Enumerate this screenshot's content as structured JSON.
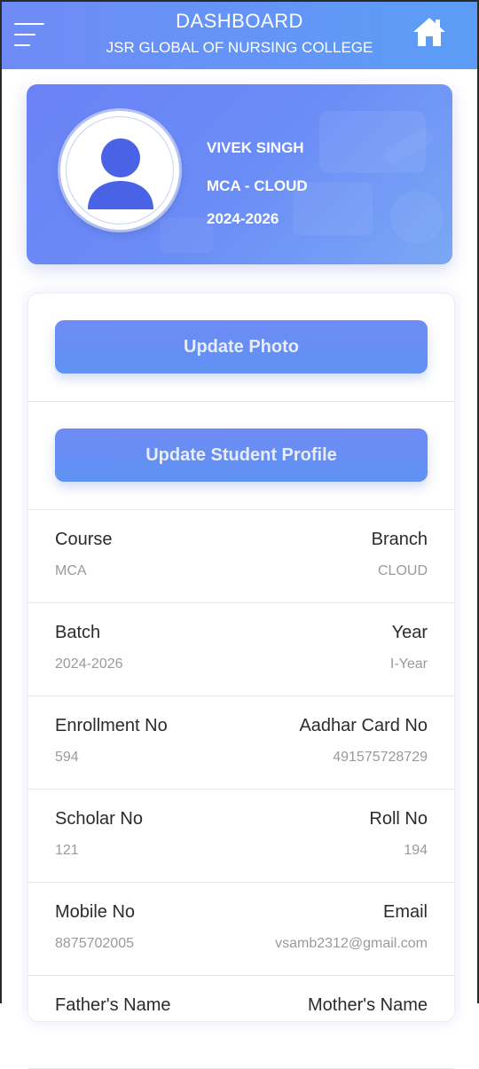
{
  "header": {
    "title": "DASHBOARD",
    "subtitle": "JSR GLOBAL OF NURSING COLLEGE"
  },
  "profile": {
    "name": "VIVEK SINGH",
    "course": "MCA - CLOUD",
    "session": "2024-2026"
  },
  "actions": {
    "update_photo": "Update Photo",
    "update_profile": "Update Student Profile"
  },
  "details": [
    {
      "left_label": "Course",
      "left_value": "MCA",
      "right_label": "Branch",
      "right_value": "CLOUD"
    },
    {
      "left_label": "Batch",
      "left_value": "2024-2026",
      "right_label": "Year",
      "right_value": "I-Year"
    },
    {
      "left_label": "Enrollment No",
      "left_value": "594",
      "right_label": "Aadhar Card No",
      "right_value": "491575728729"
    },
    {
      "left_label": "Scholar No",
      "left_value": "121",
      "right_label": "Roll No",
      "right_value": "194"
    },
    {
      "left_label": "Mobile No",
      "left_value": "8875702005",
      "right_label": "Email",
      "right_value": "vsamb2312@gmail.com"
    },
    {
      "left_label": "Father's Name",
      "left_value": "",
      "right_label": "Mother's Name",
      "right_value": ""
    }
  ],
  "colors": {
    "header_gradient_start": "#6f8bf5",
    "header_gradient_end": "#5b9df6",
    "avatar_blue": "#4a63e6",
    "label_text": "#2b2b2b",
    "value_text": "#9a9a9a"
  },
  "icons": {
    "menu": "menu-icon",
    "home": "home-icon",
    "avatar": "user-avatar-icon"
  }
}
